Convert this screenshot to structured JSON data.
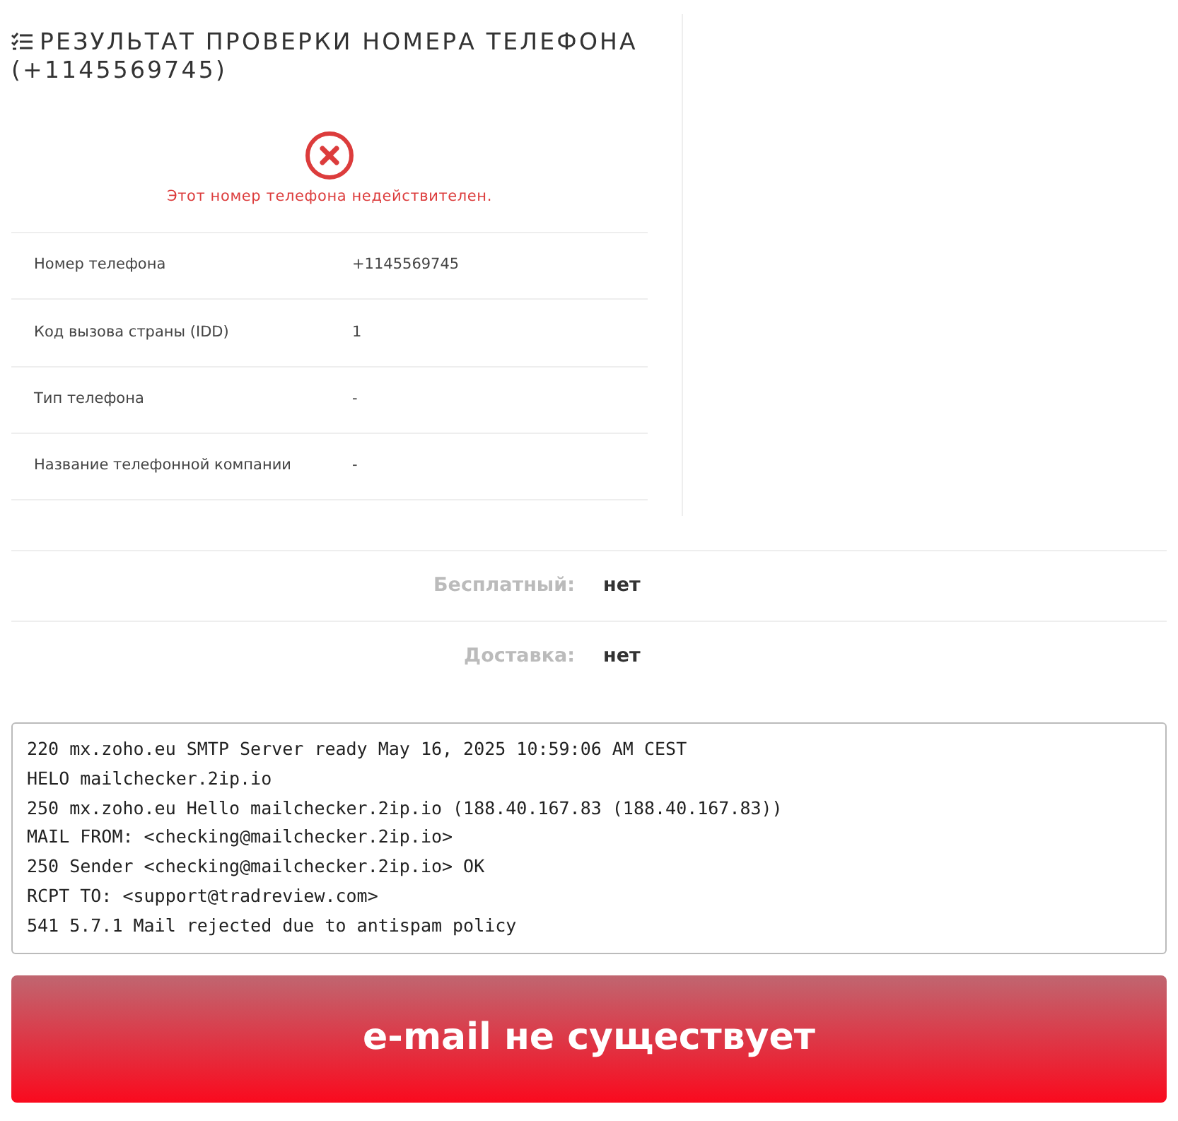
{
  "title": "РЕЗУЛЬТАТ ПРОВЕРКИ НОМЕРА ТЕЛЕФОНА (+1145569745)",
  "status": {
    "valid": false,
    "message": "Этот номер телефона недействителен."
  },
  "details": [
    {
      "label": "Номер телефона",
      "value": "+1145569745"
    },
    {
      "label": "Код вызова страны (IDD)",
      "value": "1"
    },
    {
      "label": "Тип телефона",
      "value": "-"
    },
    {
      "label": "Название телефонной компании",
      "value": "-"
    }
  ],
  "flags": [
    {
      "label": "Бесплатный:",
      "value": "нет"
    },
    {
      "label": "Доставка:",
      "value": "нет"
    }
  ],
  "smtp_log": [
    "220 mx.zoho.eu SMTP Server ready May 16, 2025 10:59:06 AM CEST",
    "HELO mailchecker.2ip.io",
    "250 mx.zoho.eu Hello mailchecker.2ip.io (188.40.167.83 (188.40.167.83))",
    "MAIL FROM: <checking@mailchecker.2ip.io>",
    "250 Sender <checking@mailchecker.2ip.io> OK",
    "RCPT TO: <support@tradreview.com>",
    "541 5.7.1 Mail rejected due to antispam policy"
  ],
  "result": {
    "exists": false,
    "text": "e-mail не существует"
  }
}
